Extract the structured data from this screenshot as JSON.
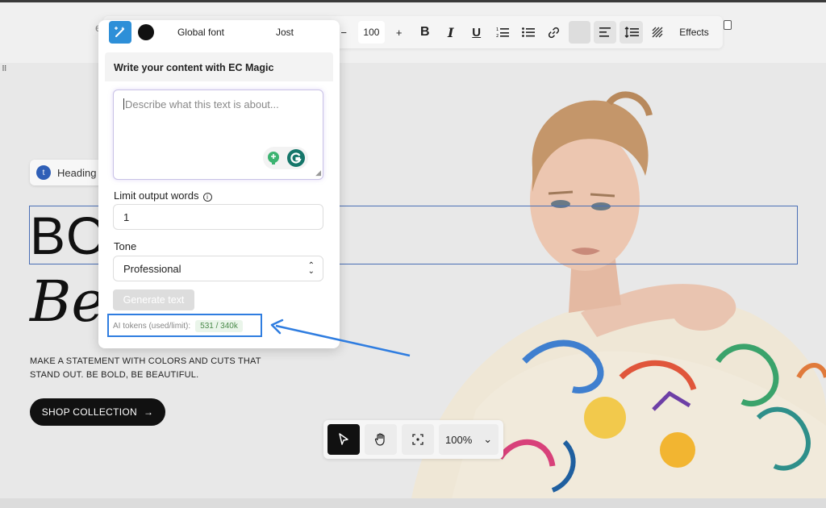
{
  "toolbar": {
    "font_button": "Global font",
    "font_family": "Jost",
    "font_size": "100",
    "minus": "−",
    "plus": "+",
    "bold": "B",
    "italic": "I",
    "underline": "U",
    "effects": "Effects",
    "text_color": "#111111"
  },
  "panel": {
    "title": "Write your content with EC Magic",
    "textarea_placeholder": "Describe what this text is about...",
    "limit_label": "Limit output words",
    "limit_value": "1",
    "tone_label": "Tone",
    "tone_value": "Professional",
    "generate_label": "Generate text",
    "tokens_label": "AI tokens (used/limit):",
    "tokens_value": "531 / 340k"
  },
  "page": {
    "heading_chip": "Heading",
    "hero_title": "BO",
    "hero_subtitle": "Be",
    "description": "MAKE A STATEMENT WITH COLORS AND CUTS THAT STAND OUT. BE BOLD, BE BEAUTIFUL.",
    "shop_button": "SHOP COLLECTION",
    "shop_arrow": "→"
  },
  "zoom": {
    "value": "100%"
  },
  "colors": {
    "accent_blue": "#2f7de0",
    "magic_button": "#2d8fd8",
    "selection_border": "#4a6fb5"
  }
}
